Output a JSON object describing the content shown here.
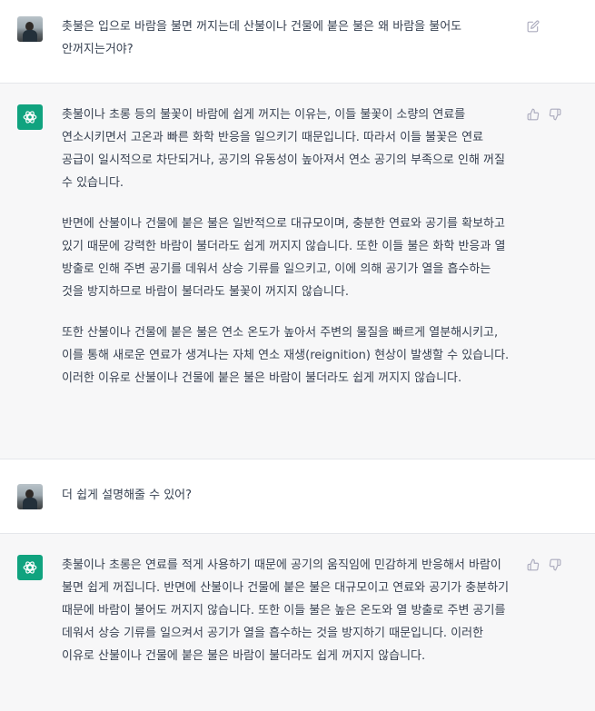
{
  "conversation": {
    "messages": [
      {
        "role": "user",
        "paragraphs": [
          "촛불은 입으로 바람을 불면 꺼지는데 산불이나 건물에 붙은 불은 왜 바람을 불어도 안꺼지는거야?"
        ]
      },
      {
        "role": "assistant",
        "paragraphs": [
          "촛불이나 초롱 등의 불꽃이 바람에 쉽게 꺼지는 이유는, 이들 불꽃이 소량의 연료를 연소시키면서 고온과 빠른 화학 반응을 일으키기 때문입니다. 따라서 이들 불꽃은 연료 공급이 일시적으로 차단되거나, 공기의 유동성이 높아져서 연소 공기의 부족으로 인해 꺼질 수 있습니다.",
          "반면에 산불이나 건물에 붙은 불은 일반적으로 대규모이며, 충분한 연료와 공기를 확보하고 있기 때문에 강력한 바람이 불더라도 쉽게 꺼지지 않습니다. 또한 이들 불은 화학 반응과 열 방출로 인해 주변 공기를 데워서 상승 기류를 일으키고, 이에 의해 공기가 열을 흡수하는 것을 방지하므로 바람이 불더라도 불꽃이 꺼지지 않습니다.",
          "또한 산불이나 건물에 붙은 불은 연소 온도가 높아서 주변의 물질을 빠르게 열분해시키고, 이를 통해 새로운 연료가 생겨나는 자체 연소 재생(reignition) 현상이 발생할 수 있습니다. 이러한 이유로 산불이나 건물에 붙은 불은 바람이 불더라도 쉽게 꺼지지 않습니다."
        ]
      },
      {
        "role": "user",
        "paragraphs": [
          "더 쉽게 설명해줄 수 있어?"
        ]
      },
      {
        "role": "assistant",
        "paragraphs": [
          "촛불이나 초롱은 연료를 적게 사용하기 때문에 공기의 움직임에 민감하게 반응해서 바람이 불면 쉽게 꺼집니다. 반면에 산불이나 건물에 붙은 불은 대규모이고 연료와 공기가 충분하기 때문에 바람이 불어도 꺼지지 않습니다. 또한 이들 불은 높은 온도와 열 방출로 주변 공기를 데워서 상승 기류를 일으켜서 공기가 열을 흡수하는 것을 방지하기 때문입니다. 이러한 이유로 산불이나 건물에 붙은 불은 바람이 불더라도 쉽게 꺼지지 않습니다."
        ]
      }
    ]
  },
  "icons": {
    "user_avatar": "user-photo-avatar",
    "assistant_avatar": "openai-logo-icon",
    "edit": "edit-icon",
    "thumbs_up": "thumbs-up-icon",
    "thumbs_down": "thumbs-down-icon"
  },
  "colors": {
    "assistant_bg": "#f7f7f8",
    "user_bg": "#ffffff",
    "brand": "#10a37f",
    "text": "#374151",
    "icon": "#acacbe"
  }
}
